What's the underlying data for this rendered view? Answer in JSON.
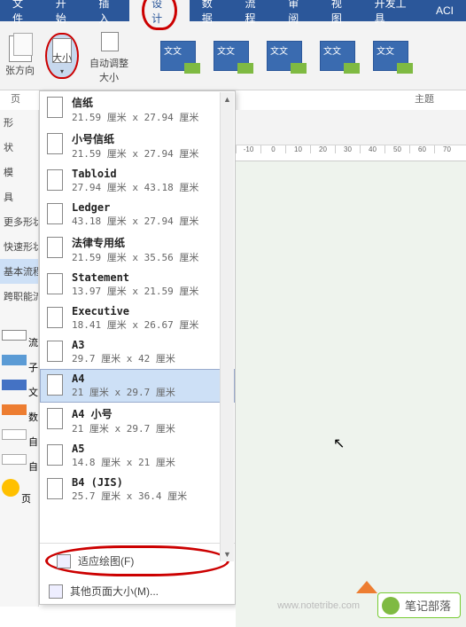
{
  "tabs": [
    "文件",
    "开始",
    "插入",
    "设计",
    "数据",
    "流程",
    "审阅",
    "视图",
    "开发工具",
    "ACI"
  ],
  "active_tab_index": 3,
  "ribbon": {
    "orientation": "张方向",
    "size": "大小",
    "autofit_l1": "自动调整",
    "autofit_l2": "大小",
    "page_group": "页",
    "theme_group": "主题"
  },
  "theme_label": "文文",
  "left_panel": {
    "rows": [
      "形",
      "状",
      "模",
      "具"
    ],
    "items": [
      "更多形状",
      "快速形状",
      "基本流程",
      "跨职能流"
    ],
    "swatches": [
      "流",
      "子",
      "文",
      "数",
      "自",
      "自",
      "页"
    ]
  },
  "size_menu": {
    "items": [
      {
        "name": "信纸",
        "dim": "21.59 厘米 x 27.94 厘米"
      },
      {
        "name": "小号信纸",
        "dim": "21.59 厘米 x 27.94 厘米"
      },
      {
        "name": "Tabloid",
        "dim": "27.94 厘米 x 43.18 厘米"
      },
      {
        "name": "Ledger",
        "dim": "43.18 厘米 x 27.94 厘米"
      },
      {
        "name": "法律专用纸",
        "dim": "21.59 厘米 x 35.56 厘米"
      },
      {
        "name": "Statement",
        "dim": "13.97 厘米 x 21.59 厘米"
      },
      {
        "name": "Executive",
        "dim": "18.41 厘米 x 26.67 厘米"
      },
      {
        "name": "A3",
        "dim": "29.7 厘米 x 42 厘米"
      },
      {
        "name": "A4",
        "dim": "21 厘米 x 29.7 厘米"
      },
      {
        "name": "A4 小号",
        "dim": "21 厘米 x 29.7 厘米"
      },
      {
        "name": "A5",
        "dim": "14.8 厘米 x 21 厘米"
      },
      {
        "name": "B4 (JIS)",
        "dim": "25.7 厘米 x 36.4 厘米"
      }
    ],
    "selected_index": 8,
    "fit": "适应绘图(F)",
    "more": "其他页面大小(M)..."
  },
  "ruler": [
    "-10",
    "0",
    "10",
    "20",
    "30",
    "40",
    "50",
    "60",
    "70"
  ],
  "watermark": {
    "brand": "笔记部落",
    "url": "www.notetribe.com"
  }
}
